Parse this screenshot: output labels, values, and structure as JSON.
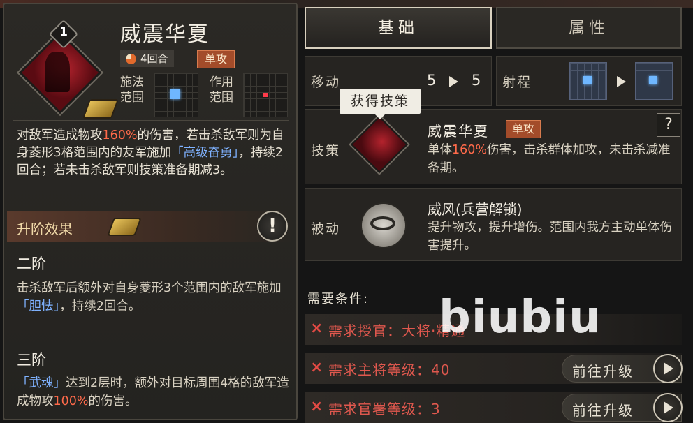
{
  "skill": {
    "level": "1",
    "title": "威震华夏",
    "rounds": "4回合",
    "type_badge": "单攻",
    "cast_range_label": "施法\n范围",
    "effect_range_label": "作用\n范围",
    "desc_parts": [
      "对敌军造成物攻",
      "160%",
      "的伤害，若击杀敌军则为自身菱形3格范围内的友军施加",
      "「高级奋勇」",
      "，持续2回合；若未击杀敌军则技策准备期减3。"
    ]
  },
  "upgrade": {
    "title": "升阶效果",
    "info_icon": "!",
    "tier2_title": "二阶",
    "tier2_parts": [
      "击杀敌军后额外对自身菱形3个范围内的敌军施加",
      "「胆怯」",
      "，持续2回合。"
    ],
    "tier3_title": "三阶",
    "tier3_parts": [
      "「武魂」",
      "达到2层时，额外对目标周围4格的敌军造成物攻",
      "100%",
      "的伤害。"
    ]
  },
  "tabs": {
    "basic": "基础",
    "attributes": "属性"
  },
  "move": {
    "label": "移动",
    "from": "5",
    "to": "5"
  },
  "range": {
    "label": "射程"
  },
  "strategy": {
    "label": "技策",
    "tooltip": "获得技策",
    "title": "威震华夏",
    "badge": "单攻",
    "help": "?",
    "desc_parts": [
      "单体",
      "160%",
      "伤害，击杀群体加攻，未击杀减准备期。"
    ]
  },
  "passive": {
    "label": "被动",
    "title": "威风(兵营解锁)",
    "desc": "提升物攻，提升增伤。范围内我方主动单体伤害提升。"
  },
  "requirements": {
    "title": "需要条件:",
    "items": [
      {
        "mark": "×",
        "text": "需求授官：大将·精通"
      },
      {
        "mark": "×",
        "text": "需求主将等级：40",
        "button": "前往升级"
      },
      {
        "mark": "×",
        "text": "需求官署等级：3",
        "button": "前往升级"
      }
    ]
  },
  "watermark": "biubiu",
  "colors": {
    "highlight_red": "#ff6a4a",
    "highlight_blue": "#7fb2ff",
    "requirement_red": "#e0584e",
    "badge": "#a34c2a"
  },
  "icons": {
    "skill": "skill-diamond-icon",
    "rounds": "clock-icon",
    "cloud": "cloud-ornament-icon",
    "passive": "wind-emblem-icon",
    "goto": "arrow-right-icon"
  }
}
